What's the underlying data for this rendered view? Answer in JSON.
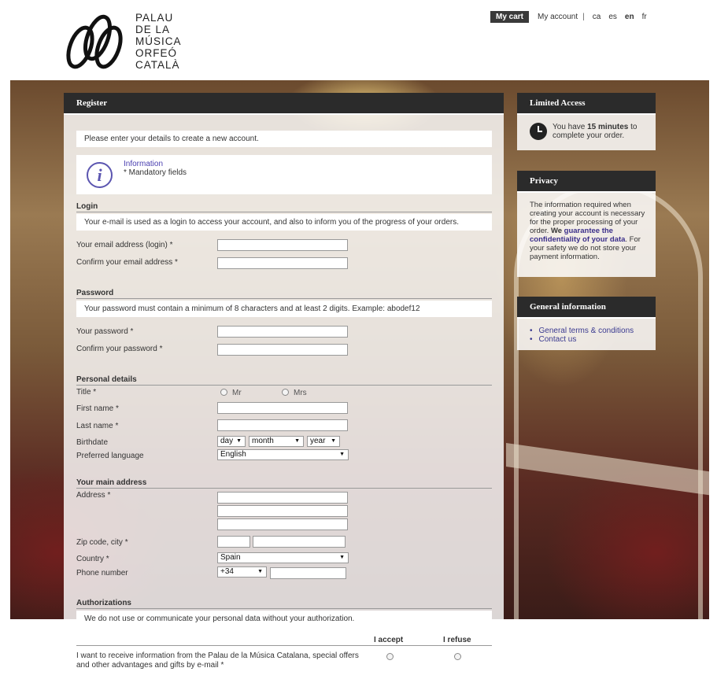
{
  "logo": {
    "line1": "PALAU",
    "line2": "DE LA",
    "line3": "MÚSICA",
    "line4": "ORFEÓ",
    "line5": "CATALÀ"
  },
  "topnav": {
    "cart": "My cart",
    "account": "My account",
    "separator": "|",
    "languages": [
      {
        "code": "ca",
        "active": false
      },
      {
        "code": "es",
        "active": false
      },
      {
        "code": "en",
        "active": true
      },
      {
        "code": "fr",
        "active": false
      }
    ]
  },
  "register": {
    "title": "Register",
    "intro": "Please enter your details to create a new account.",
    "info_title": "Information",
    "info_sub": "* Mandatory fields",
    "login": {
      "title": "Login",
      "note": "Your e-mail is used as a login to access your account, and also to inform you of the progress of your orders.",
      "email": "Your email address (login) *",
      "confirm_email": "Confirm your email address *"
    },
    "password": {
      "title": "Password",
      "note": "Your password must contain a minimum of 8 characters and at least 2 digits. Example: abodef12",
      "password": "Your password *",
      "confirm_password": "Confirm your password *"
    },
    "personal": {
      "title": "Personal details",
      "title_label": "Title  *",
      "mr": "Mr",
      "mrs": "Mrs",
      "first_name": "First name *",
      "last_name": "Last name *",
      "birthdate": "Birthdate",
      "day": "day",
      "month": "month",
      "year": "year",
      "language": "Preferred language",
      "language_value": "English"
    },
    "address": {
      "title": "Your main address",
      "address": "Address *",
      "zip": "Zip code, city  *",
      "country": "Country *",
      "country_value": "Spain",
      "phone": "Phone number",
      "phone_prefix": "+34"
    },
    "authorizations": {
      "title": "Authorizations",
      "note": "We do not use or communicate your personal data without your authorization.",
      "accept": "I accept",
      "refuse": "I refuse",
      "item": "I want to receive information from the Palau de la Música Catalana, special offers and other advantages and gifts by e-mail *"
    }
  },
  "limited": {
    "title": "Limited Access",
    "text_pre": "You have ",
    "text_bold": "15 minutes",
    "text_post": " to complete your order."
  },
  "privacy": {
    "title": "Privacy",
    "text_pre": "The information required when creating your account is necessary for the proper processing of your order. ",
    "text_bold1": "We ",
    "text_bold2": "guarantee the confidentiality of your data",
    "text_post": ". For your safety we do not store your payment information."
  },
  "general": {
    "title": "General information",
    "links": [
      "General terms & conditions",
      "Contact us"
    ]
  }
}
